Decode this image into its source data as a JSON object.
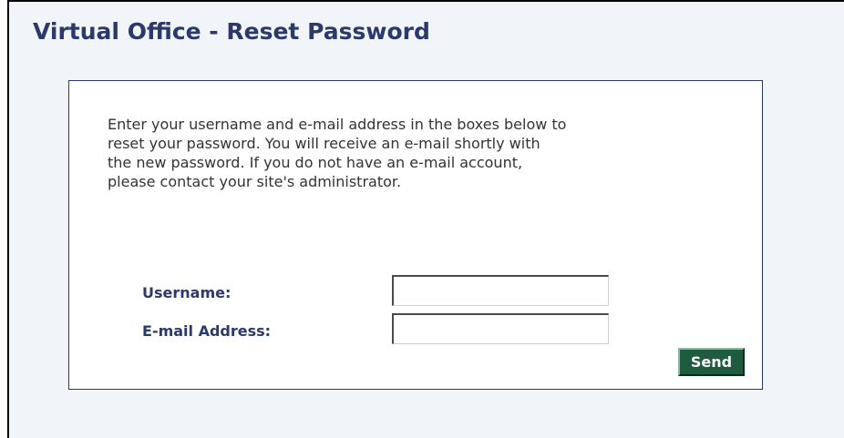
{
  "page": {
    "title": "Virtual Office - Reset Password"
  },
  "form": {
    "instructions": "Enter your username and e-mail address in the boxes below to\nreset your password.  You will receive an e-mail shortly with\nthe new password. If you do not have an e-mail account,\nplease contact your site's administrator.",
    "username_label": "Username:",
    "username_value": "",
    "email_label": "E-mail Address:",
    "email_value": "",
    "send_label": "Send"
  }
}
